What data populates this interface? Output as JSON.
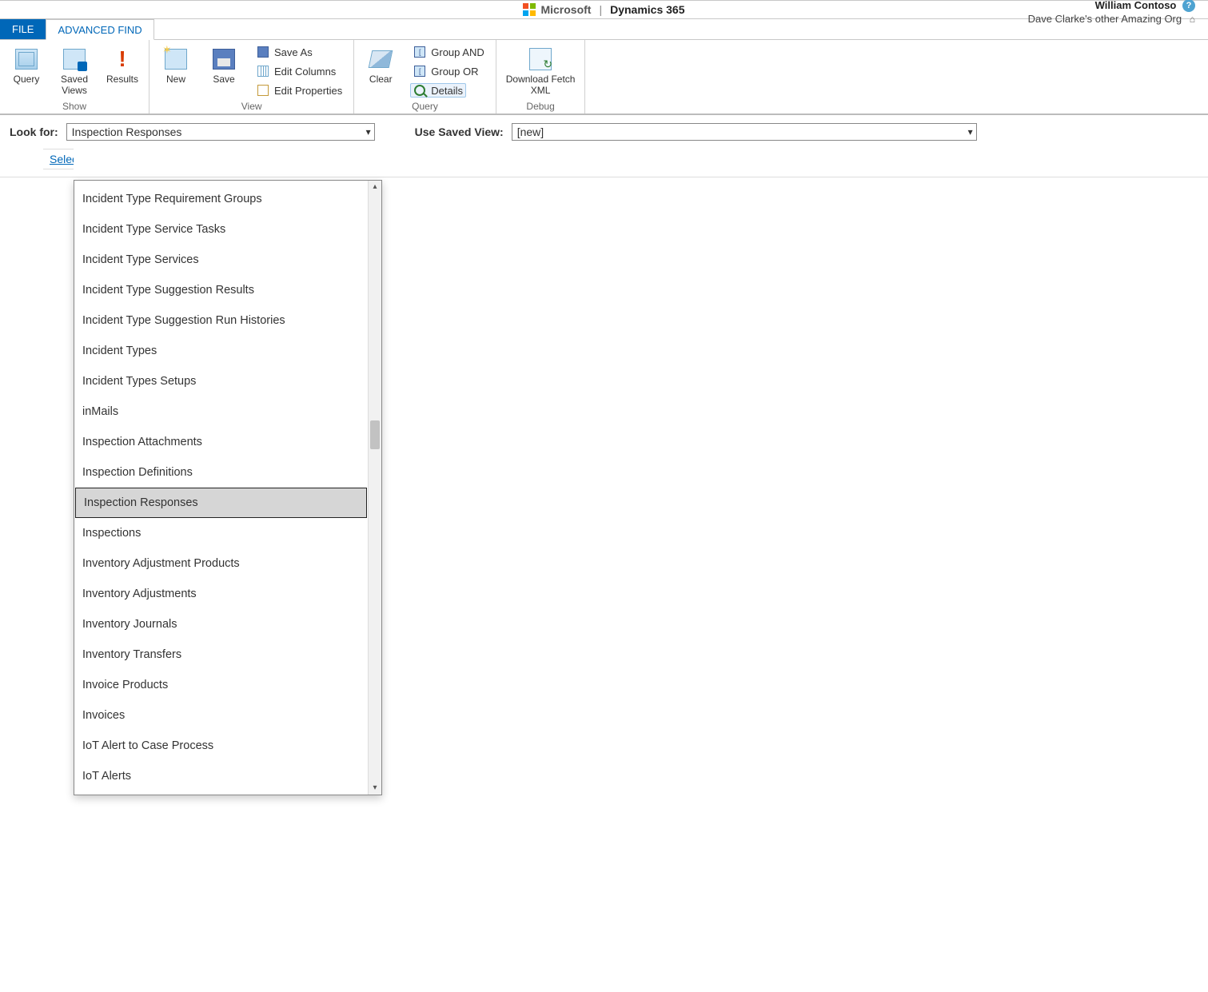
{
  "header": {
    "ms_label": "Microsoft",
    "product": "Dynamics 365",
    "user_name": "William Contoso",
    "org_name": "Dave Clarke's other Amazing Org"
  },
  "tabs": {
    "file": "FILE",
    "advanced_find": "ADVANCED FIND"
  },
  "ribbon": {
    "show": {
      "label": "Show",
      "query": "Query",
      "saved_views": "Saved\nViews",
      "results": "Results"
    },
    "view": {
      "label": "View",
      "new": "New",
      "save": "Save",
      "save_as": "Save As",
      "edit_columns": "Edit Columns",
      "edit_properties": "Edit Properties"
    },
    "query": {
      "label": "Query",
      "clear": "Clear",
      "group_and": "Group AND",
      "group_or": "Group OR",
      "details": "Details"
    },
    "debug": {
      "label": "Debug",
      "download_fetch": "Download Fetch\nXML"
    }
  },
  "form": {
    "look_for_label": "Look for:",
    "look_for_value": "Inspection Responses",
    "saved_view_label": "Use Saved View:",
    "saved_view_value": "[new]",
    "select_link": "Select"
  },
  "dropdown": {
    "selected": "Inspection Responses",
    "items": [
      "Incident Type Requirement Groups",
      "Incident Type Service Tasks",
      "Incident Type Services",
      "Incident Type Suggestion Results",
      "Incident Type Suggestion Run Histories",
      "Incident Types",
      "Incident Types Setups",
      "inMails",
      "Inspection Attachments",
      "Inspection Definitions",
      "Inspection Responses",
      "Inspections",
      "Inventory Adjustment Products",
      "Inventory Adjustments",
      "Inventory Journals",
      "Inventory Transfers",
      "Invoice Products",
      "Invoices",
      "IoT Alert to Case Process",
      "IoT Alerts"
    ]
  }
}
